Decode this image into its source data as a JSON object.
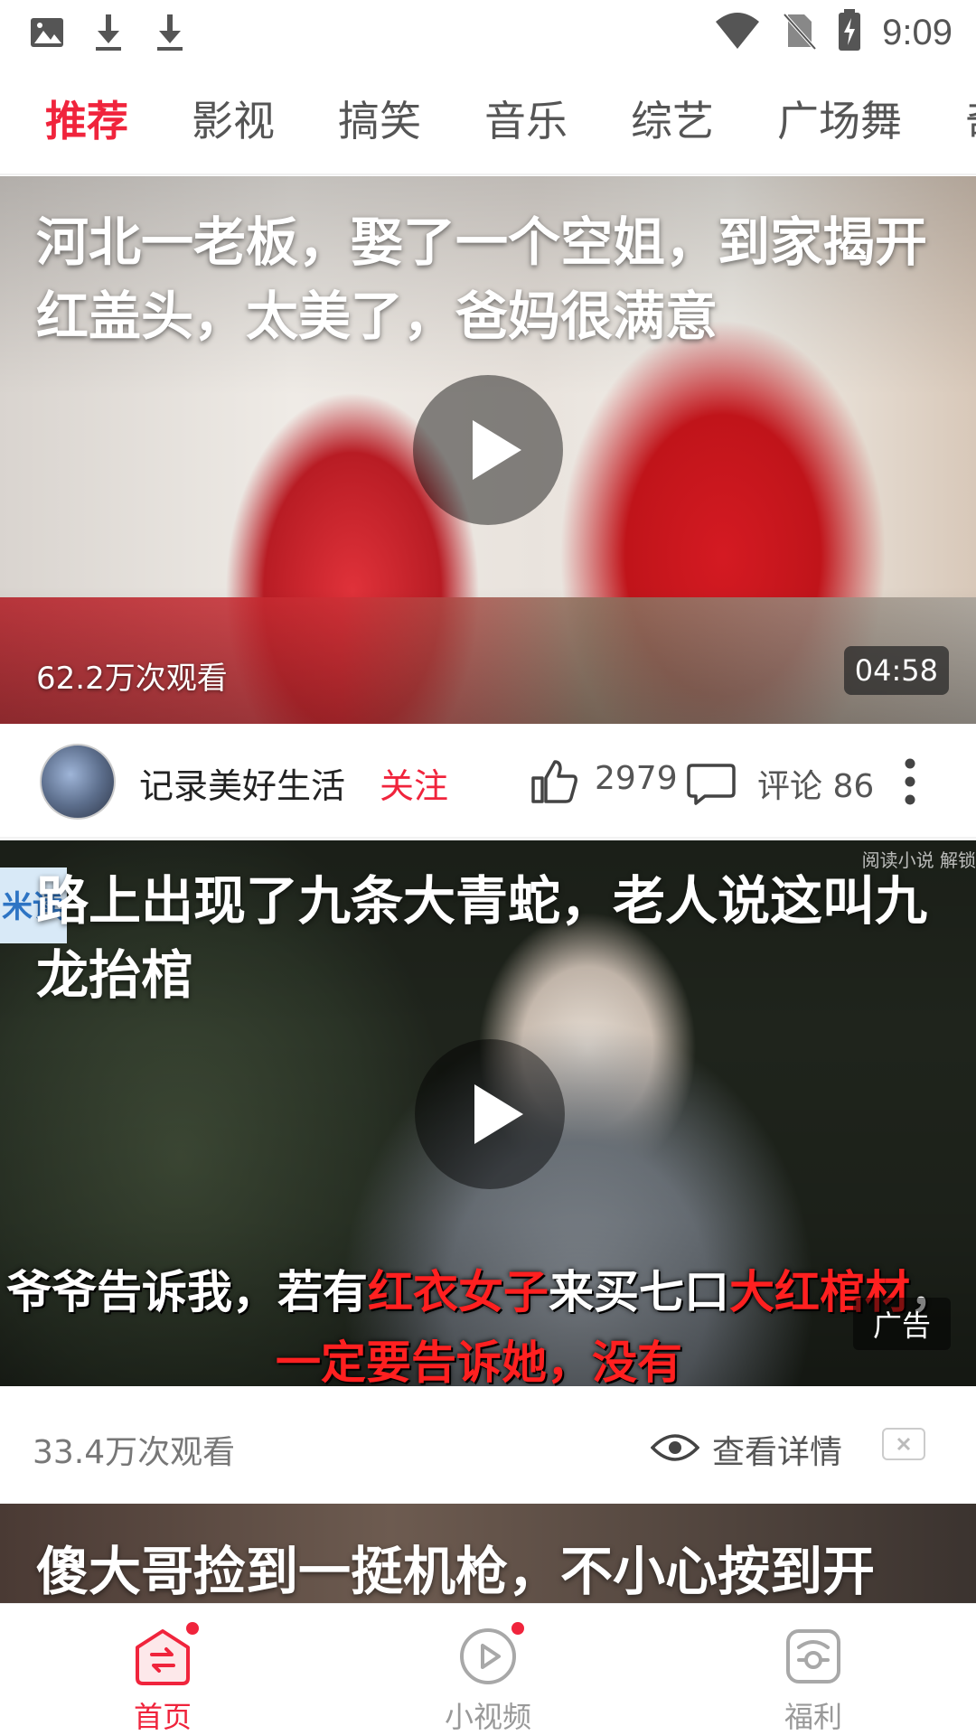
{
  "status_bar": {
    "time": "9:09",
    "icons": [
      "image-icon",
      "download-icon",
      "download-icon",
      "wifi-icon",
      "no-sim-icon",
      "battery-charging-icon"
    ]
  },
  "tabs": [
    {
      "label": "推荐",
      "active": true
    },
    {
      "label": "影视",
      "active": false
    },
    {
      "label": "搞笑",
      "active": false
    },
    {
      "label": "音乐",
      "active": false
    },
    {
      "label": "综艺",
      "active": false
    },
    {
      "label": "广场舞",
      "active": false
    },
    {
      "label": "奇",
      "active": false
    }
  ],
  "feed": {
    "video1": {
      "title": "河北一老板，娶了一个空姐，到家揭开红盖头，太美了，爸妈很满意",
      "views": "62.2万次观看",
      "duration": "04:58",
      "author": "记录美好生活",
      "follow_label": "关注",
      "likes": "2979",
      "comments": "评论 86"
    },
    "video2": {
      "title": "路上出现了九条大青蛇，老人说这叫九龙抬棺",
      "caption_line1_a": "爷爷告诉我，若有",
      "caption_line1_b": "红衣女子",
      "caption_line1_c": "来买七口",
      "caption_line1_d": "大红棺材",
      "caption_line1_e": "，",
      "caption_line2": "一定要告诉她，没有",
      "ad_label": "广告",
      "watermark": "阅读小说 解锁",
      "logo_text": "米读",
      "views": "33.4万次观看",
      "detail_label": "查看详情"
    },
    "video3": {
      "title": "傻大哥捡到一挺机枪，不小心按到开"
    }
  },
  "bottom_nav": [
    {
      "label": "首页",
      "icon": "home-icon",
      "active": true,
      "badge": true
    },
    {
      "label": "小视频",
      "icon": "play-circle-icon",
      "active": false,
      "badge": true
    },
    {
      "label": "福利",
      "icon": "gift-icon",
      "active": false,
      "badge": false
    }
  ],
  "colors": {
    "accent": "#f0243c",
    "text_primary": "#222222",
    "text_secondary": "#777777"
  }
}
